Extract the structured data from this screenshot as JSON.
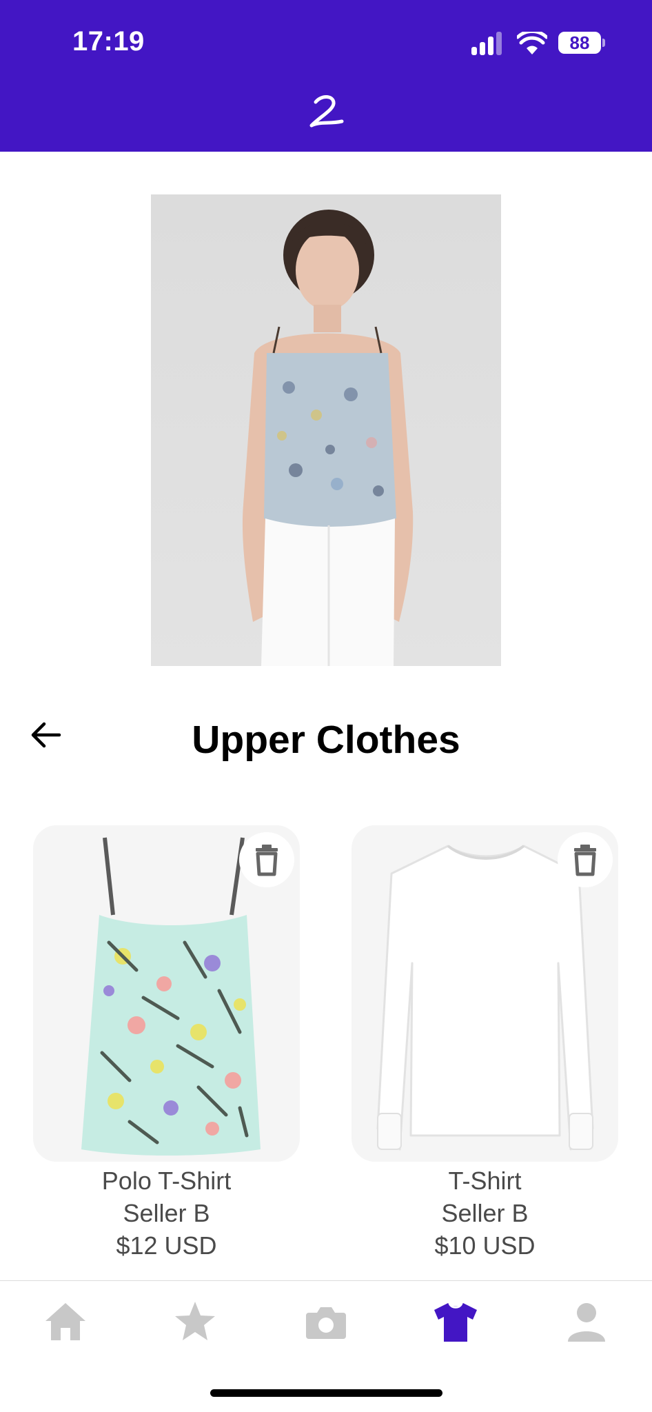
{
  "status_bar": {
    "time": "17:19",
    "battery": "88"
  },
  "header": {
    "logo_icon": "script-l-logo"
  },
  "page": {
    "title": "Upper Clothes",
    "back_icon": "arrow-left-icon"
  },
  "items": [
    {
      "name": "Polo T-Shirt",
      "seller": "Seller B",
      "price": "$12 USD",
      "image": "floral-camisole-top"
    },
    {
      "name": "T-Shirt",
      "seller": "Seller B",
      "price": "$10 USD",
      "image": "white-long-sleeve-top"
    }
  ],
  "tab_bar": {
    "tabs": [
      {
        "icon": "home-icon",
        "active": false
      },
      {
        "icon": "star-icon",
        "active": false
      },
      {
        "icon": "camera-icon",
        "active": false
      },
      {
        "icon": "tshirt-icon",
        "active": true
      },
      {
        "icon": "user-icon",
        "active": false
      }
    ]
  },
  "colors": {
    "brand": "#4316c4",
    "inactive_icon": "#c8c8c8",
    "text_muted": "#4a4a4a"
  }
}
